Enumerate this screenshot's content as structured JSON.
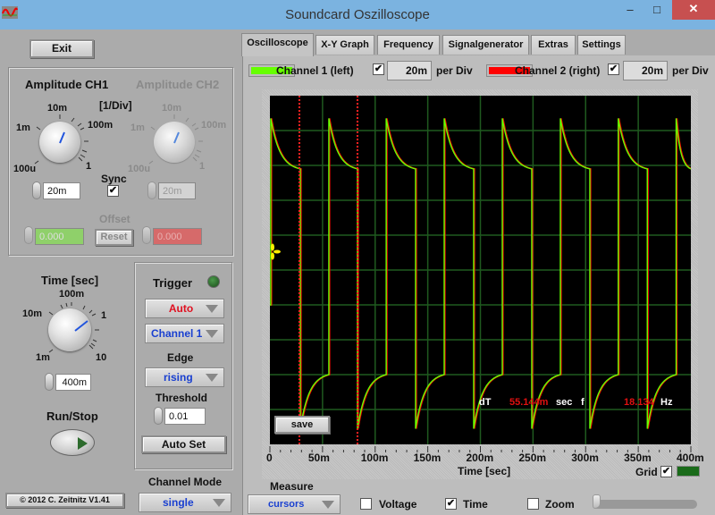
{
  "window": {
    "title": "Soundcard Oszilloscope",
    "controls": {
      "minimize": "–",
      "maximize": "□",
      "close": "✕"
    }
  },
  "left_panel": {
    "exit_label": "Exit",
    "amplitude": {
      "ch1_title": "Amplitude CH1",
      "ch2_title": "Amplitude CH2",
      "unit_label": "[1/Div]",
      "knob_labels": [
        "100u",
        "1m",
        "10m",
        "100m",
        "1"
      ],
      "ch1_value": "20m",
      "ch2_value": "20m",
      "sync_label": "Sync",
      "sync_checked": true,
      "offset_label": "Offset",
      "offset_ch1": "0.000",
      "offset_ch2": "0.000",
      "reset_label": "Reset"
    },
    "time": {
      "title": "Time [sec]",
      "knob_labels": [
        "1m",
        "10m",
        "100m",
        "1",
        "10"
      ],
      "value": "400m"
    },
    "run_stop_label": "Run/Stop",
    "trigger": {
      "title": "Trigger",
      "mode": "Auto",
      "source": "Channel 1",
      "edge_label": "Edge",
      "edge": "rising",
      "threshold_label": "Threshold",
      "threshold": "0.01",
      "autoset_label": "Auto Set"
    },
    "channel_mode_label": "Channel Mode",
    "channel_mode": "single",
    "copyright": "© 2012  C. Zeitnitz V1.41"
  },
  "tabs": [
    {
      "label": "Oscilloscope",
      "active": true
    },
    {
      "label": "X-Y Graph",
      "active": false
    },
    {
      "label": "Frequency",
      "active": false
    },
    {
      "label": "Signalgenerator",
      "active": false
    },
    {
      "label": "Extras",
      "active": false
    },
    {
      "label": "Settings",
      "active": false
    }
  ],
  "channels": {
    "ch1": {
      "label": "Channel 1 (left)",
      "color": "#66ff00",
      "enabled": true,
      "per_div": "20m",
      "per_div_label": "per Div"
    },
    "ch2": {
      "label": "Channel 2 (right)",
      "color": "#ff0000",
      "enabled": true,
      "per_div": "20m",
      "per_div_label": "per Div"
    }
  },
  "measurement": {
    "dT_label": "dT",
    "dT_value": "55.144m",
    "dT_unit": "sec",
    "f_label": "f",
    "f_value": "18.134",
    "f_unit": "Hz"
  },
  "save_label": "save",
  "grid_label": "Grid",
  "grid_checked": true,
  "bottom": {
    "measure_label": "Measure",
    "measure_mode": "cursors",
    "voltage_label": "Voltage",
    "voltage_checked": false,
    "time_label": "Time",
    "time_checked": true,
    "zoom_label": "Zoom",
    "zoom_checked": false,
    "zoom_slider": 0
  },
  "chart_data": {
    "type": "line",
    "title": "",
    "xlabel": "Time [sec]",
    "ylabel": "",
    "xlim": [
      0,
      400
    ],
    "ylim": [
      -100,
      100
    ],
    "x_unit": "ms",
    "y_unit": "mV",
    "x_ticks": [
      "0",
      "50m",
      "100m",
      "150m",
      "200m",
      "250m",
      "300m",
      "350m",
      "400m"
    ],
    "x_divisions": 8,
    "y_divisions": 10,
    "grid": true,
    "signal": {
      "shape": "AC-coupled square wave",
      "period_ms": 55.144,
      "frequency_hz": 18.134,
      "rising_edges_ms": [
        0.8,
        56,
        110.5,
        165.6,
        220.8,
        276,
        331,
        386
      ],
      "falling_edges_ms": [
        28.9,
        83.2,
        138.4,
        193.6,
        248.8,
        304,
        358.6
      ],
      "high_peak_mV": 87,
      "high_end_mV": 58,
      "low_peak_mV": -91,
      "low_end_mV": -60
    },
    "series": [
      {
        "name": "Channel 1 (left)",
        "color": "#66ff00"
      },
      {
        "name": "Channel 2 (right)",
        "color": "#ff0000"
      }
    ],
    "cursors_ms": [
      28.0,
      83.2
    ],
    "trigger_level_mV": 10
  }
}
